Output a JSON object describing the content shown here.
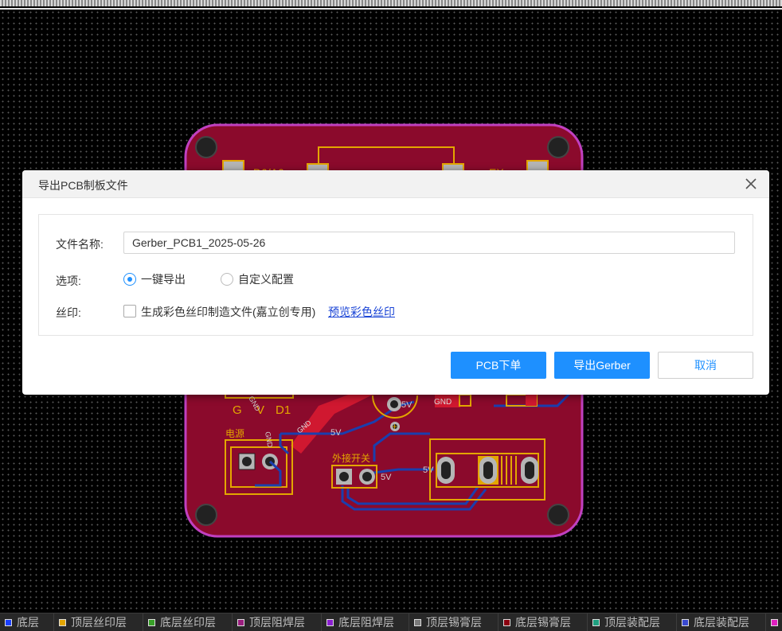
{
  "dialog": {
    "title": "导出PCB制板文件",
    "filename_label": "文件名称:",
    "filename_value": "Gerber_PCB1_2025-05-26",
    "options_label": "选项:",
    "option_one_click": "一键导出",
    "option_custom": "自定义配置",
    "selected_option": "一键导出",
    "silkscreen_label": "丝印:",
    "silkscreen_checkbox_text": "生成彩色丝印制造文件(嘉立创专用)",
    "silkscreen_checked": false,
    "preview_link": "预览彩色丝印",
    "btn_pcb_order": "PCB下单",
    "btn_export": "导出Gerber",
    "btn_cancel": "取消"
  },
  "pcb": {
    "labels": {
      "d0a0": "D0/A0",
      "ex": "EX",
      "g": "G",
      "v": "V",
      "d1": "D1",
      "power": "电源",
      "ext_switch": "外接开关",
      "net_5v_1": "5V",
      "net_5v_2": "5V",
      "net_5v_3": "5V",
      "net_5v_4": "5V",
      "gnd_1": "GND",
      "gnd_2": "GND",
      "gnd_3": "GND",
      "gnd_4": "GND",
      "plus": "+"
    },
    "colors": {
      "board": "#8b0a2c",
      "outline": "#c040c0",
      "silk": "#e3a600",
      "copper": "#d01830",
      "trace_bottom": "#1a3fae"
    }
  },
  "layers": [
    {
      "name": "底层",
      "color": "#1a3fff"
    },
    {
      "name": "顶层丝印层",
      "color": "#e3a600"
    },
    {
      "name": "底层丝印层",
      "color": "#38a028"
    },
    {
      "name": "顶层阻焊层",
      "color": "#9a1f7e"
    },
    {
      "name": "底层阻焊层",
      "color": "#8a1fd0"
    },
    {
      "name": "顶层锡膏层",
      "color": "#7a7a7a"
    },
    {
      "name": "底层锡膏层",
      "color": "#8a0010"
    },
    {
      "name": "顶层装配层",
      "color": "#20a080"
    },
    {
      "name": "底层装配层",
      "color": "#3a4ad0"
    },
    {
      "name": "",
      "color": "#e020c0"
    }
  ]
}
